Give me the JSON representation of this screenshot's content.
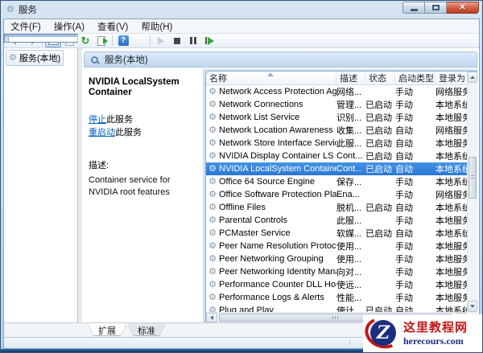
{
  "window": {
    "title": "服务"
  },
  "menu": {
    "items": [
      {
        "label": "文件(F)"
      },
      {
        "label": "操作(A)"
      },
      {
        "label": "查看(V)"
      },
      {
        "label": "帮助(H)"
      }
    ]
  },
  "toolbar": {
    "icons": [
      "back-icon",
      "forward-icon",
      "show-window-icon",
      "properties-icon",
      "refresh-icon",
      "export-list-icon",
      "help-icon",
      "show-console-tree-icon",
      "start-service-icon",
      "stop-service-icon",
      "pause-service-icon",
      "restart-service-icon"
    ]
  },
  "tree": {
    "root_label": "服务(本地)"
  },
  "panel": {
    "header_title": "服务(本地)",
    "service_title": "NVIDIA LocalSystem Container",
    "stop_action": "停止",
    "stop_suffix": "此服务",
    "restart_action": "重启动",
    "restart_suffix": "此服务",
    "description_label": "描述:",
    "description_text": "Container service for NVIDIA root features"
  },
  "services": {
    "columns": {
      "name": "名称",
      "desc": "描述",
      "status": "状态",
      "startup": "启动类型",
      "logon": "登录为"
    },
    "rows": [
      {
        "name": "Network Access Protection Agent",
        "desc": "网络...",
        "status": "",
        "startup": "手动",
        "logon": "网络服务"
      },
      {
        "name": "Network Connections",
        "desc": "管理...",
        "status": "已启动",
        "startup": "手动",
        "logon": "本地系统"
      },
      {
        "name": "Network List Service",
        "desc": "识别...",
        "status": "已启动",
        "startup": "手动",
        "logon": "本地服务"
      },
      {
        "name": "Network Location Awareness",
        "desc": "收集...",
        "status": "已启动",
        "startup": "自动",
        "logon": "网络服务"
      },
      {
        "name": "Network Store Interface Service",
        "desc": "此服...",
        "status": "已启动",
        "startup": "自动",
        "logon": "本地服务"
      },
      {
        "name": "NVIDIA Display Container LS",
        "desc": "Cont...",
        "status": "已启动",
        "startup": "自动",
        "logon": "本地系统"
      },
      {
        "name": "NVIDIA LocalSystem Container",
        "desc": "Cont...",
        "status": "已启动",
        "startup": "自动",
        "logon": "本地系统"
      },
      {
        "name": "Office 64 Source Engine",
        "desc": "保存...",
        "status": "",
        "startup": "手动",
        "logon": "本地系统"
      },
      {
        "name": "Office Software Protection Platfo...",
        "desc": "Ena...",
        "status": "",
        "startup": "手动",
        "logon": "网络服务"
      },
      {
        "name": "Offline Files",
        "desc": "脱机...",
        "status": "已启动",
        "startup": "自动",
        "logon": "本地系统"
      },
      {
        "name": "Parental Controls",
        "desc": "此服...",
        "status": "",
        "startup": "手动",
        "logon": "本地服务"
      },
      {
        "name": "PCMaster Service",
        "desc": "软媒...",
        "status": "已启动",
        "startup": "自动",
        "logon": "本地系统"
      },
      {
        "name": "Peer Name Resolution Protocol",
        "desc": "使用...",
        "status": "",
        "startup": "手动",
        "logon": "本地服务"
      },
      {
        "name": "Peer Networking Grouping",
        "desc": "使用...",
        "status": "",
        "startup": "手动",
        "logon": "本地服务"
      },
      {
        "name": "Peer Networking Identity Manager",
        "desc": "向对...",
        "status": "",
        "startup": "手动",
        "logon": "本地服务"
      },
      {
        "name": "Performance Counter DLL Host",
        "desc": "使远...",
        "status": "",
        "startup": "手动",
        "logon": "本地服务"
      },
      {
        "name": "Performance Logs & Alerts",
        "desc": "性能...",
        "status": "",
        "startup": "手动",
        "logon": "本地服务"
      },
      {
        "name": "Plug and Play",
        "desc": "使计...",
        "status": "已启动",
        "startup": "自动",
        "logon": "本地系统"
      }
    ],
    "selected_row": "NVIDIA LocalSystem Container"
  },
  "tabs": {
    "extended": "扩展",
    "standard": "标准"
  },
  "watermark": {
    "logo_letter": "Z",
    "site_name": "这里教程网",
    "domain": "herecours.com"
  },
  "colors": {
    "selection_blue": "#3282dd",
    "link_blue": "#0563c1",
    "panel_header_blue": "#cde0f2",
    "close_button_red": "#c1371f",
    "watermark_red": "#c01818",
    "watermark_navy": "#1b2e7e"
  }
}
